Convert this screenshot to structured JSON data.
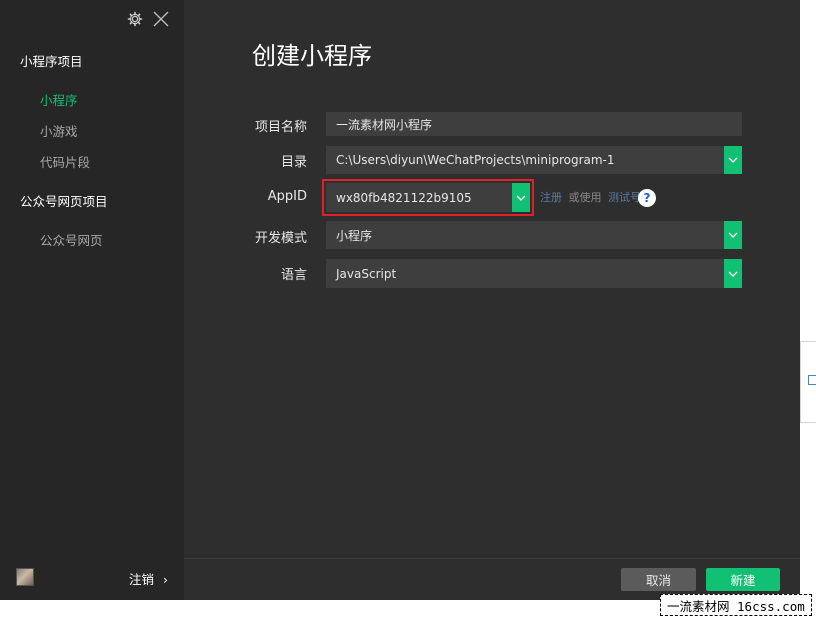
{
  "sidebar": {
    "groups": [
      {
        "title": "小程序项目",
        "items": [
          {
            "label": "小程序",
            "active": true
          },
          {
            "label": "小游戏",
            "active": false
          },
          {
            "label": "代码片段",
            "active": false
          }
        ]
      },
      {
        "title": "公众号网页项目",
        "items": [
          {
            "label": "公众号网页",
            "active": false
          }
        ]
      }
    ],
    "logout_label": "注销",
    "logout_arrow": "›"
  },
  "main": {
    "title": "创建小程序",
    "form": {
      "project_name": {
        "label": "项目名称",
        "value": "一流素材网小程序"
      },
      "directory": {
        "label": "目录",
        "value": "C:\\Users\\diyun\\WeChatProjects\\miniprogram-1"
      },
      "appid": {
        "label": "AppID",
        "value": "wx80fb4821122b9105"
      },
      "dev_mode": {
        "label": "开发模式",
        "value": "小程序"
      },
      "language": {
        "label": "语言",
        "value": "JavaScript"
      }
    },
    "appid_links": {
      "register": "注册",
      "or_use": "或使用",
      "test_account": "测试号"
    },
    "help_glyph": "?"
  },
  "footer": {
    "cancel_label": "取消",
    "create_label": "新建"
  },
  "watermark": "一流素材网 16css.com",
  "colors": {
    "accent": "#12c074",
    "highlight": "#e0202a",
    "sidebar_bg": "#262626",
    "main_bg": "#2e2e2e"
  }
}
